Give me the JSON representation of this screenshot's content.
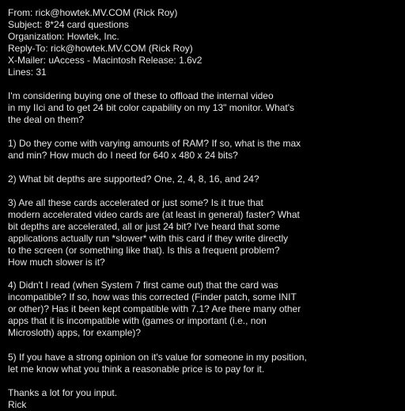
{
  "email": {
    "headers": [
      "From: rick@howtek.MV.COM (Rick Roy)",
      "Subject: 8*24 card questions",
      "Organization: Howtek, Inc.",
      "Reply-To: rick@howtek.MV.COM (Rick Roy)",
      "X-Mailer: uAccess - Macintosh Release: 1.6v2",
      "Lines: 31"
    ],
    "body": [
      [
        "I'm considering buying one of these to offload the internal video",
        "in my IIci and to get 24 bit color capability on my 13\" monitor. What's",
        "the deal on them?"
      ],
      [
        "1) Do they come with varying amounts of RAM? If so, what is the max",
        "and min? How much do I need for 640 x 480 x 24 bits?"
      ],
      [
        "2) What bit depths are supported? One, 2, 4, 8, 16, and 24?"
      ],
      [
        "3) Are all these cards accelerated or just some? Is it true that",
        "modern accelerated video cards are (at least in general) faster? What",
        "bit depths are accelerated, all or just 24 bit? I've heard that some",
        "applications actually run *slower* with this card if they write directly",
        "to the screen (or something like that). Is this a frequent problem?",
        "How much slower is it?"
      ],
      [
        "4) Didn't I read (when System 7 first came out) that the card was",
        "incompatible? If so, how was this corrected (Finder patch, some INIT",
        "or other)? Has it been kept compatible with 7.1? Are there many other",
        "apps that it is incompatible with (games or important (i.e., non",
        "Microsloth) apps, for example)?"
      ],
      [
        "5) If you have a strong opinion on it's value for someone in my position,",
        "let me know what you think a reasonable price is to pay for it."
      ],
      [
        "Thanks a lot for you input.",
        "Rick"
      ]
    ]
  }
}
